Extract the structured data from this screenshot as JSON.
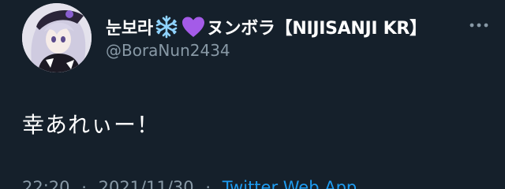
{
  "tweet": {
    "display_name_ko": "눈보라",
    "display_name_jp": "ヌンボラ",
    "display_name_bracket": "【NIJISANJI KR】",
    "handle": "@BoraNun2434",
    "text": "幸あれぃー！",
    "time": "22:20",
    "date": "2021/11/30",
    "separator": "·",
    "source": "Twitter Web App",
    "icons": {
      "avatar": "avatar-image",
      "snowflake": "snowflake-emoji",
      "heart": "purple-heart-emoji",
      "more": "more-options-icon"
    }
  },
  "colors": {
    "background": "#15202b",
    "text": "#ffffff",
    "secondary": "#8899a6",
    "link": "#1d9bf0",
    "heart": "#a45be8",
    "snowflake": "#8fd3ff"
  }
}
